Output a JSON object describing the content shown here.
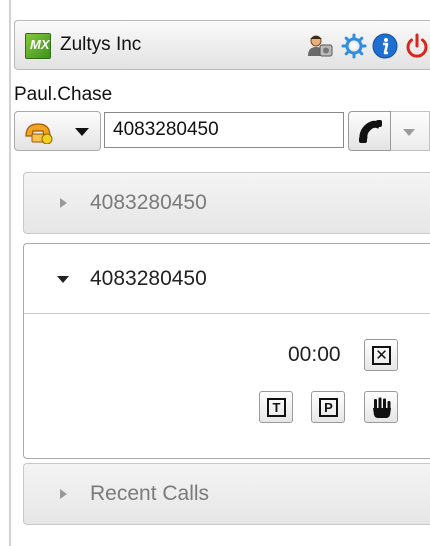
{
  "header": {
    "company_name": "Zultys Inc",
    "logo_text": "MX",
    "icons": [
      "users-icon",
      "gear-icon",
      "info-icon",
      "power-icon"
    ]
  },
  "user": {
    "name": "Paul.Chase"
  },
  "dialer": {
    "number_value": "4083280450",
    "presence_icon": "phone-presence-icon",
    "call_icon": "handset-icon"
  },
  "panels": [
    {
      "label": "4083280450",
      "expanded": false
    },
    {
      "label": "4083280450",
      "expanded": true,
      "timer": "00:00",
      "buttons": [
        {
          "name": "hangup",
          "glyph": "✕"
        },
        {
          "name": "transfer",
          "glyph": "T"
        },
        {
          "name": "park",
          "glyph": "P"
        },
        {
          "name": "hold",
          "icon": "hand-icon"
        }
      ]
    },
    {
      "label": "Recent Calls",
      "expanded": false
    }
  ],
  "colors": {
    "logo_green": "#5aad27",
    "gear_blue": "#2f8ee0",
    "info_blue": "#1d6fd1",
    "power_red": "#d9251d",
    "presence_orange": "#f2a321"
  }
}
